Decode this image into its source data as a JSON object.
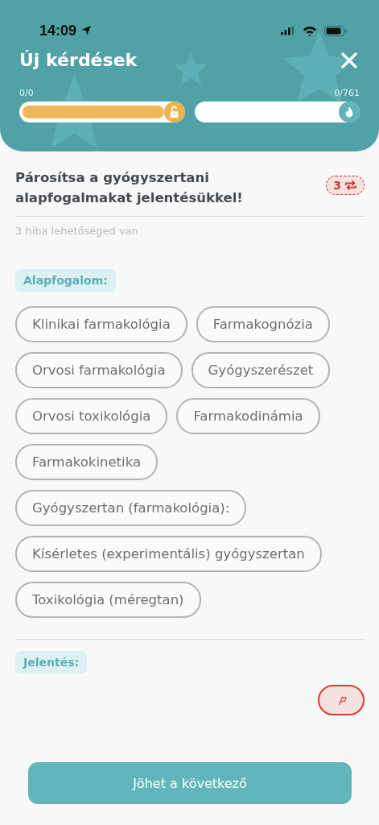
{
  "status_bar": {
    "time": "14:09"
  },
  "header": {
    "title": "Új kérdések"
  },
  "progress": [
    {
      "kind": "unlock",
      "reading": "0/0"
    },
    {
      "kind": "flame",
      "reading": "0/761"
    }
  ],
  "question": {
    "text": "Párosítsa a gyógyszertani alapfogalmakat jelentésükkel!",
    "retry_count": "3",
    "hint": "3 hiba lehetőséged van"
  },
  "terms_label": "Alapfogalom:",
  "terms": [
    "Klinikai farmakológia",
    "Farmakognózia",
    "Orvosi farmakológia",
    "Gyógyszerészet",
    "Orvosi toxikológia",
    "Farmakodinámia",
    "Farmakokinetika",
    "Gyógyszertan (farmakológia):",
    "Kísérletes (experimentális) gyógyszertan",
    "Toxikológia (méregtan)"
  ],
  "meanings_label": "Jelentés:",
  "next_button": "Jöhet a következő"
}
